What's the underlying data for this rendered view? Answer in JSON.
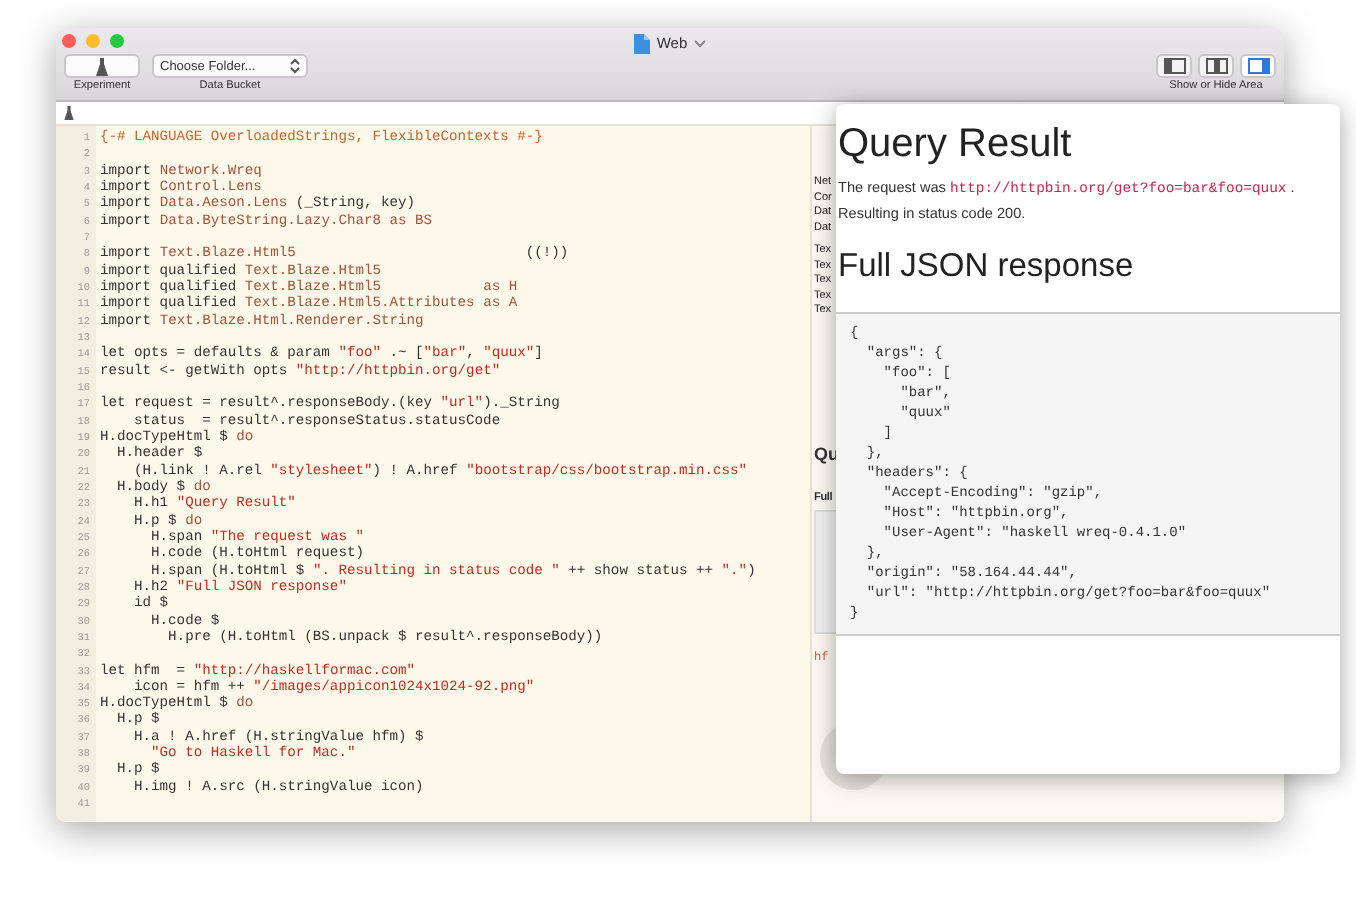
{
  "window": {
    "title": "Web"
  },
  "toolbar": {
    "experiment_label": "Experiment",
    "folder_popup": {
      "value": "Choose Folder..."
    },
    "folder_label": "Data Bucket",
    "area_label": "Show or Hide Area",
    "area_toggles": [
      {
        "kind": "left",
        "selected": false
      },
      {
        "kind": "middle",
        "selected": false
      },
      {
        "kind": "right",
        "selected": true
      }
    ]
  },
  "editor": {
    "lines": [
      {
        "n": "1",
        "segs": [
          {
            "kind": "pragma",
            "text": "{-# LANGUAGE OverloadedStrings, FlexibleContexts #-}"
          }
        ]
      },
      {
        "n": "2"
      },
      {
        "n": "3",
        "segs": [
          {
            "kind": "plain",
            "text": "import "
          },
          {
            "kind": "module",
            "text": "Network.Wreq"
          }
        ]
      },
      {
        "n": "4",
        "segs": [
          {
            "kind": "plain",
            "text": "import "
          },
          {
            "kind": "module",
            "text": "Control.Lens"
          }
        ]
      },
      {
        "n": "5",
        "segs": [
          {
            "kind": "plain",
            "text": "import "
          },
          {
            "kind": "module",
            "text": "Data.Aeson.Lens"
          },
          {
            "kind": "plain",
            "text": " (_String, key)"
          }
        ]
      },
      {
        "n": "6",
        "segs": [
          {
            "kind": "plain",
            "text": "import "
          },
          {
            "kind": "module",
            "text": "Data.ByteString.Lazy.Char8 as BS"
          }
        ]
      },
      {
        "n": "7"
      },
      {
        "n": "8",
        "segs": [
          {
            "kind": "plain",
            "text": "import "
          },
          {
            "kind": "module",
            "text": "Text.Blaze.Html5"
          },
          {
            "kind": "plain",
            "text": "                           ((!))"
          }
        ]
      },
      {
        "n": "9",
        "segs": [
          {
            "kind": "plain",
            "text": "import qualified "
          },
          {
            "kind": "module",
            "text": "Text.Blaze.Html5"
          }
        ]
      },
      {
        "n": "10",
        "segs": [
          {
            "kind": "plain",
            "text": "import qualified "
          },
          {
            "kind": "module",
            "text": "Text.Blaze.Html5            as H"
          }
        ]
      },
      {
        "n": "11",
        "segs": [
          {
            "kind": "plain",
            "text": "import qualified "
          },
          {
            "kind": "module",
            "text": "Text.Blaze.Html5.Attributes as A"
          }
        ]
      },
      {
        "n": "12",
        "segs": [
          {
            "kind": "plain",
            "text": "import "
          },
          {
            "kind": "module",
            "text": "Text.Blaze.Html.Renderer.String"
          }
        ]
      },
      {
        "n": "13"
      },
      {
        "n": "14",
        "segs": [
          {
            "kind": "plain",
            "text": "let opts = defaults & param "
          },
          {
            "kind": "string",
            "text": "\"foo\""
          },
          {
            "kind": "plain",
            "text": " .~ ["
          },
          {
            "kind": "string",
            "text": "\"bar\""
          },
          {
            "kind": "plain",
            "text": ", "
          },
          {
            "kind": "string",
            "text": "\"quux\""
          },
          {
            "kind": "plain",
            "text": "]"
          }
        ]
      },
      {
        "n": "15",
        "segs": [
          {
            "kind": "plain",
            "text": "result <- getWith opts "
          },
          {
            "kind": "string",
            "text": "\"http://httpbin.org/get\""
          }
        ]
      },
      {
        "n": "16"
      },
      {
        "n": "17",
        "segs": [
          {
            "kind": "plain",
            "text": "let request = result^.responseBody.(key "
          },
          {
            "kind": "string",
            "text": "\"url\""
          },
          {
            "kind": "plain",
            "text": ")._String"
          }
        ]
      },
      {
        "n": "18",
        "segs": [
          {
            "kind": "plain",
            "text": "    status  = result^.responseStatus.statusCode"
          }
        ]
      },
      {
        "n": "19",
        "segs": [
          {
            "kind": "plain",
            "text": "H.docTypeHtml $ "
          },
          {
            "kind": "module",
            "text": "do"
          }
        ]
      },
      {
        "n": "20",
        "segs": [
          {
            "kind": "plain",
            "text": "  H.header $"
          }
        ]
      },
      {
        "n": "21",
        "segs": [
          {
            "kind": "plain",
            "text": "    (H.link ! A.rel "
          },
          {
            "kind": "string",
            "text": "\"stylesheet\""
          },
          {
            "kind": "plain",
            "text": ") ! A.href "
          },
          {
            "kind": "string",
            "text": "\"bootstrap/css/bootstrap.min.css\""
          }
        ]
      },
      {
        "n": "22",
        "segs": [
          {
            "kind": "plain",
            "text": "  H.body $ "
          },
          {
            "kind": "module",
            "text": "do"
          }
        ]
      },
      {
        "n": "23",
        "segs": [
          {
            "kind": "plain",
            "text": "    H.h1 "
          },
          {
            "kind": "string",
            "text": "\"Query Result\""
          }
        ]
      },
      {
        "n": "24",
        "segs": [
          {
            "kind": "plain",
            "text": "    H.p $ "
          },
          {
            "kind": "module",
            "text": "do"
          }
        ]
      },
      {
        "n": "25",
        "segs": [
          {
            "kind": "plain",
            "text": "      H.span "
          },
          {
            "kind": "string",
            "text": "\"The request was \""
          }
        ]
      },
      {
        "n": "26",
        "segs": [
          {
            "kind": "plain",
            "text": "      H.code (H.toHtml request)"
          }
        ]
      },
      {
        "n": "27",
        "segs": [
          {
            "kind": "plain",
            "text": "      H.span (H.toHtml $ "
          },
          {
            "kind": "string",
            "text": "\". Resulting in status code \""
          },
          {
            "kind": "plain",
            "text": " ++ show status ++ "
          },
          {
            "kind": "string",
            "text": "\".\""
          },
          {
            "kind": "plain",
            "text": ")"
          }
        ]
      },
      {
        "n": "28",
        "segs": [
          {
            "kind": "plain",
            "text": "    H.h2 "
          },
          {
            "kind": "string",
            "text": "\"Full JSON response\""
          }
        ]
      },
      {
        "n": "29",
        "segs": [
          {
            "kind": "plain",
            "text": "    id $"
          }
        ]
      },
      {
        "n": "30",
        "segs": [
          {
            "kind": "plain",
            "text": "      H.code $"
          }
        ]
      },
      {
        "n": "31",
        "segs": [
          {
            "kind": "plain",
            "text": "        H.pre (H.toHtml (BS.unpack $ result^.responseBody))"
          }
        ]
      },
      {
        "n": "32"
      },
      {
        "n": "33",
        "segs": [
          {
            "kind": "plain",
            "text": "let hfm  = "
          },
          {
            "kind": "string",
            "text": "\"http://haskellformac.com\""
          }
        ]
      },
      {
        "n": "34",
        "segs": [
          {
            "kind": "plain",
            "text": "    icon = hfm ++ "
          },
          {
            "kind": "string",
            "text": "\"/images/appicon1024x1024-92.png\""
          }
        ]
      },
      {
        "n": "35",
        "segs": [
          {
            "kind": "plain",
            "text": "H.docTypeHtml $ "
          },
          {
            "kind": "module",
            "text": "do"
          }
        ]
      },
      {
        "n": "36",
        "segs": [
          {
            "kind": "plain",
            "text": "  H.p $"
          }
        ]
      },
      {
        "n": "37",
        "segs": [
          {
            "kind": "plain",
            "text": "    H.a ! A.href (H.stringValue hfm) $"
          }
        ]
      },
      {
        "n": "38",
        "segs": [
          {
            "kind": "string",
            "text": "      \"Go to Haskell for Mac.\""
          }
        ]
      },
      {
        "n": "39",
        "segs": [
          {
            "kind": "plain",
            "text": "  H.p $"
          }
        ]
      },
      {
        "n": "40",
        "segs": [
          {
            "kind": "plain",
            "text": "    H.img ! A.src (H.stringValue icon)"
          }
        ]
      },
      {
        "n": "41"
      }
    ]
  },
  "result_pane": {
    "imports": [
      "Net",
      "Cor",
      "Dat",
      "Dat"
    ],
    "blaze_imports": [
      "Tex",
      "Tex",
      "Tex",
      "Tex",
      "Tex"
    ],
    "heading": "Qu",
    "subheading": "Full",
    "code_text": "hf"
  },
  "popover": {
    "title": "Query Result",
    "request_text": "The request was",
    "request_url": "http://httpbin.org/get?foo=bar&foo=quux",
    "status_text": ". Resulting in status code 200.",
    "subtitle": "Full JSON response",
    "json_lines": [
      "{",
      "  \"args\": {",
      "    \"foo\": [",
      "      \"bar\",",
      "      \"quux\"",
      "    ]",
      "  },",
      "  \"headers\": {",
      "    \"Accept-Encoding\": \"gzip\",",
      "    \"Host\": \"httpbin.org\",",
      "    \"User-Agent\": \"haskell wreq-0.4.1.0\"",
      "  },",
      "  \"origin\": \"58.164.44.44\",",
      "  \"url\": \"http://httpbin.org/get?foo=bar&foo=quux\"",
      "}"
    ]
  }
}
